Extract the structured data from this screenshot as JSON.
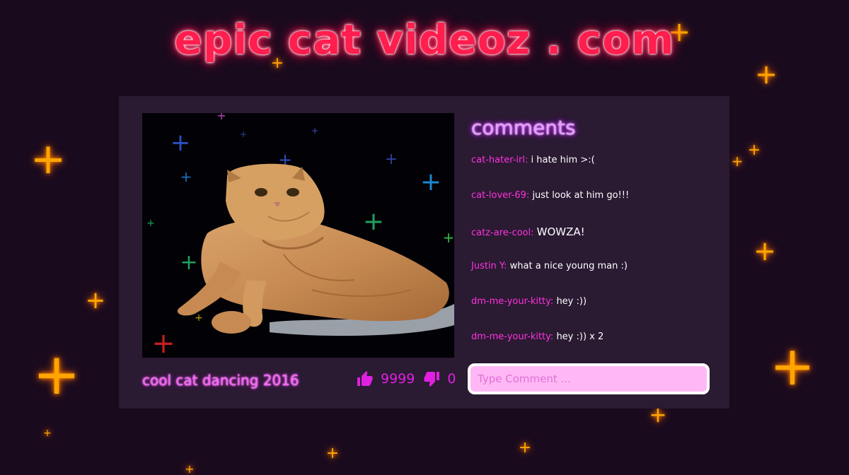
{
  "site": {
    "title": "epic cat videoz . com"
  },
  "video": {
    "title": "cool cat dancing 2016",
    "likes": "9999",
    "dislikes": "0"
  },
  "comments": {
    "heading": "comments",
    "items": [
      {
        "user": "cat-hater-irl:",
        "text": "i hate him >:("
      },
      {
        "user": "cat-lover-69:",
        "text": "just look at him go!!!"
      },
      {
        "user": "catz-are-cool:",
        "text": "WOWZA!"
      },
      {
        "user": "Justin Y:",
        "text": "what a nice young man :)"
      },
      {
        "user": "dm-me-your-kitty:",
        "text": "hey :))"
      },
      {
        "user": "dm-me-your-kitty:",
        "text": "hey :)) x 2"
      }
    ],
    "input_placeholder": "Type Comment ..."
  },
  "colors": {
    "background": "#1a0a1e",
    "panel": "#2a1a32",
    "title": "#ff1e4e",
    "accent": "#ff33dd",
    "sparkle": "#ffa500"
  },
  "icons": {
    "like": "thumbs-up-icon",
    "dislike": "thumbs-down-icon",
    "sparkle": "sparkle-icon"
  }
}
